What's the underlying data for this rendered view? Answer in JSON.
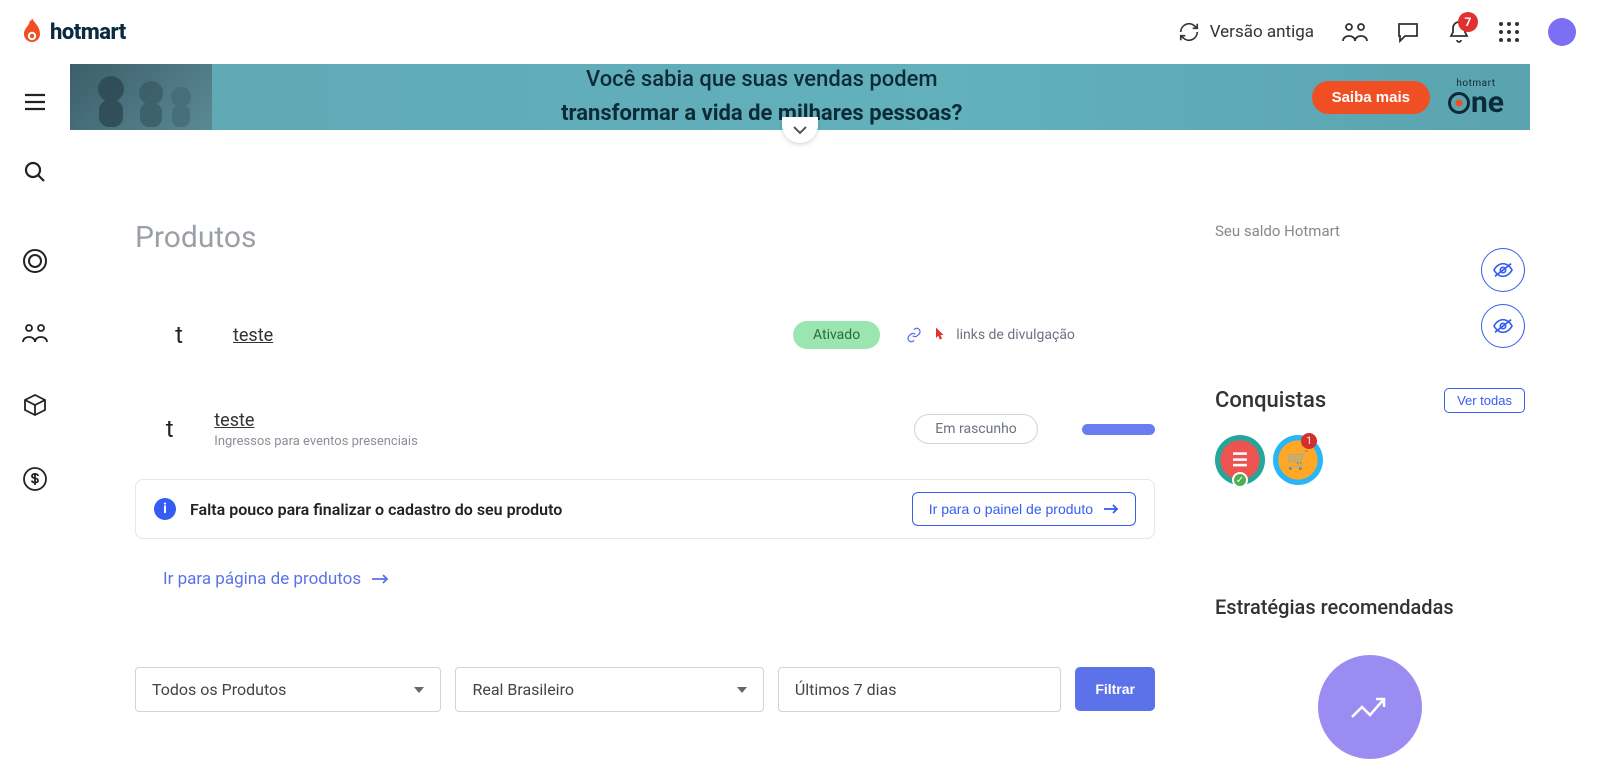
{
  "header": {
    "brand": "hotmart",
    "old_version_label": "Versão antiga",
    "notif_count": "7"
  },
  "banner": {
    "line1": "Você sabia que suas vendas podem",
    "line2": "transformar a vida de milhares pessoas?",
    "cta": "Saiba mais",
    "one_small": "hotmart",
    "one_big": "ne"
  },
  "page": {
    "title": "Produtos"
  },
  "products": [
    {
      "thumb": "t",
      "name": "teste",
      "status": "Ativado",
      "links_label": "links de divulgação"
    },
    {
      "thumb": "t",
      "name": "teste",
      "subtitle": "Ingressos para eventos presenciais",
      "status": "Em rascunho"
    }
  ],
  "callout": {
    "text": "Falta pouco para finalizar o cadastro do seu produto",
    "button": "Ir para o painel de produto"
  },
  "link_more": "Ir para página de produtos",
  "filters": {
    "product": "Todos os Produtos",
    "currency": "Real Brasileiro",
    "range": "Últimos 7 dias",
    "button": "Filtrar"
  },
  "balance": {
    "label": "Seu saldo Hotmart"
  },
  "achievements": {
    "title": "Conquistas",
    "button": "Ver todas"
  },
  "strategies": {
    "title": "Estratégias recomendadas"
  }
}
